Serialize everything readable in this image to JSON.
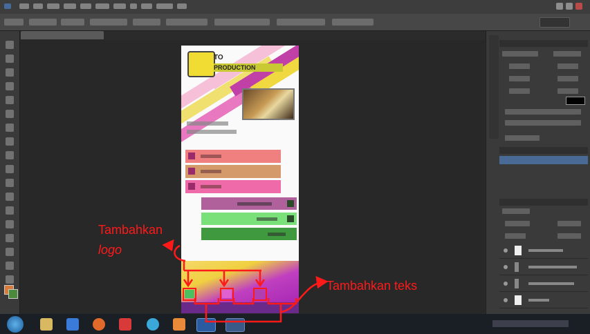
{
  "annotations": {
    "add_logo_line1": "Tambahkan",
    "add_logo_line2": "logo",
    "add_text": "Tambahkan teks"
  },
  "app_design": {
    "title_line1": "TO",
    "title_line2": "PRODUCTION"
  },
  "colors": {
    "annotation": "#ff1a1a",
    "photoshop_bg": "#2b2b2b",
    "menu_btn_1": "#f08080",
    "menu_btn_2": "#d49a6a",
    "menu_btn_3": "#ee6aa8",
    "action_btn_1": "#b0609a",
    "action_btn_2": "#7ae07a",
    "action_btn_3": "#3f9a3f"
  },
  "icons": [
    "windows-start-icon",
    "explorer-icon",
    "media-player-icon",
    "firefox-icon",
    "gmail-icon",
    "photoshop-icon"
  ]
}
